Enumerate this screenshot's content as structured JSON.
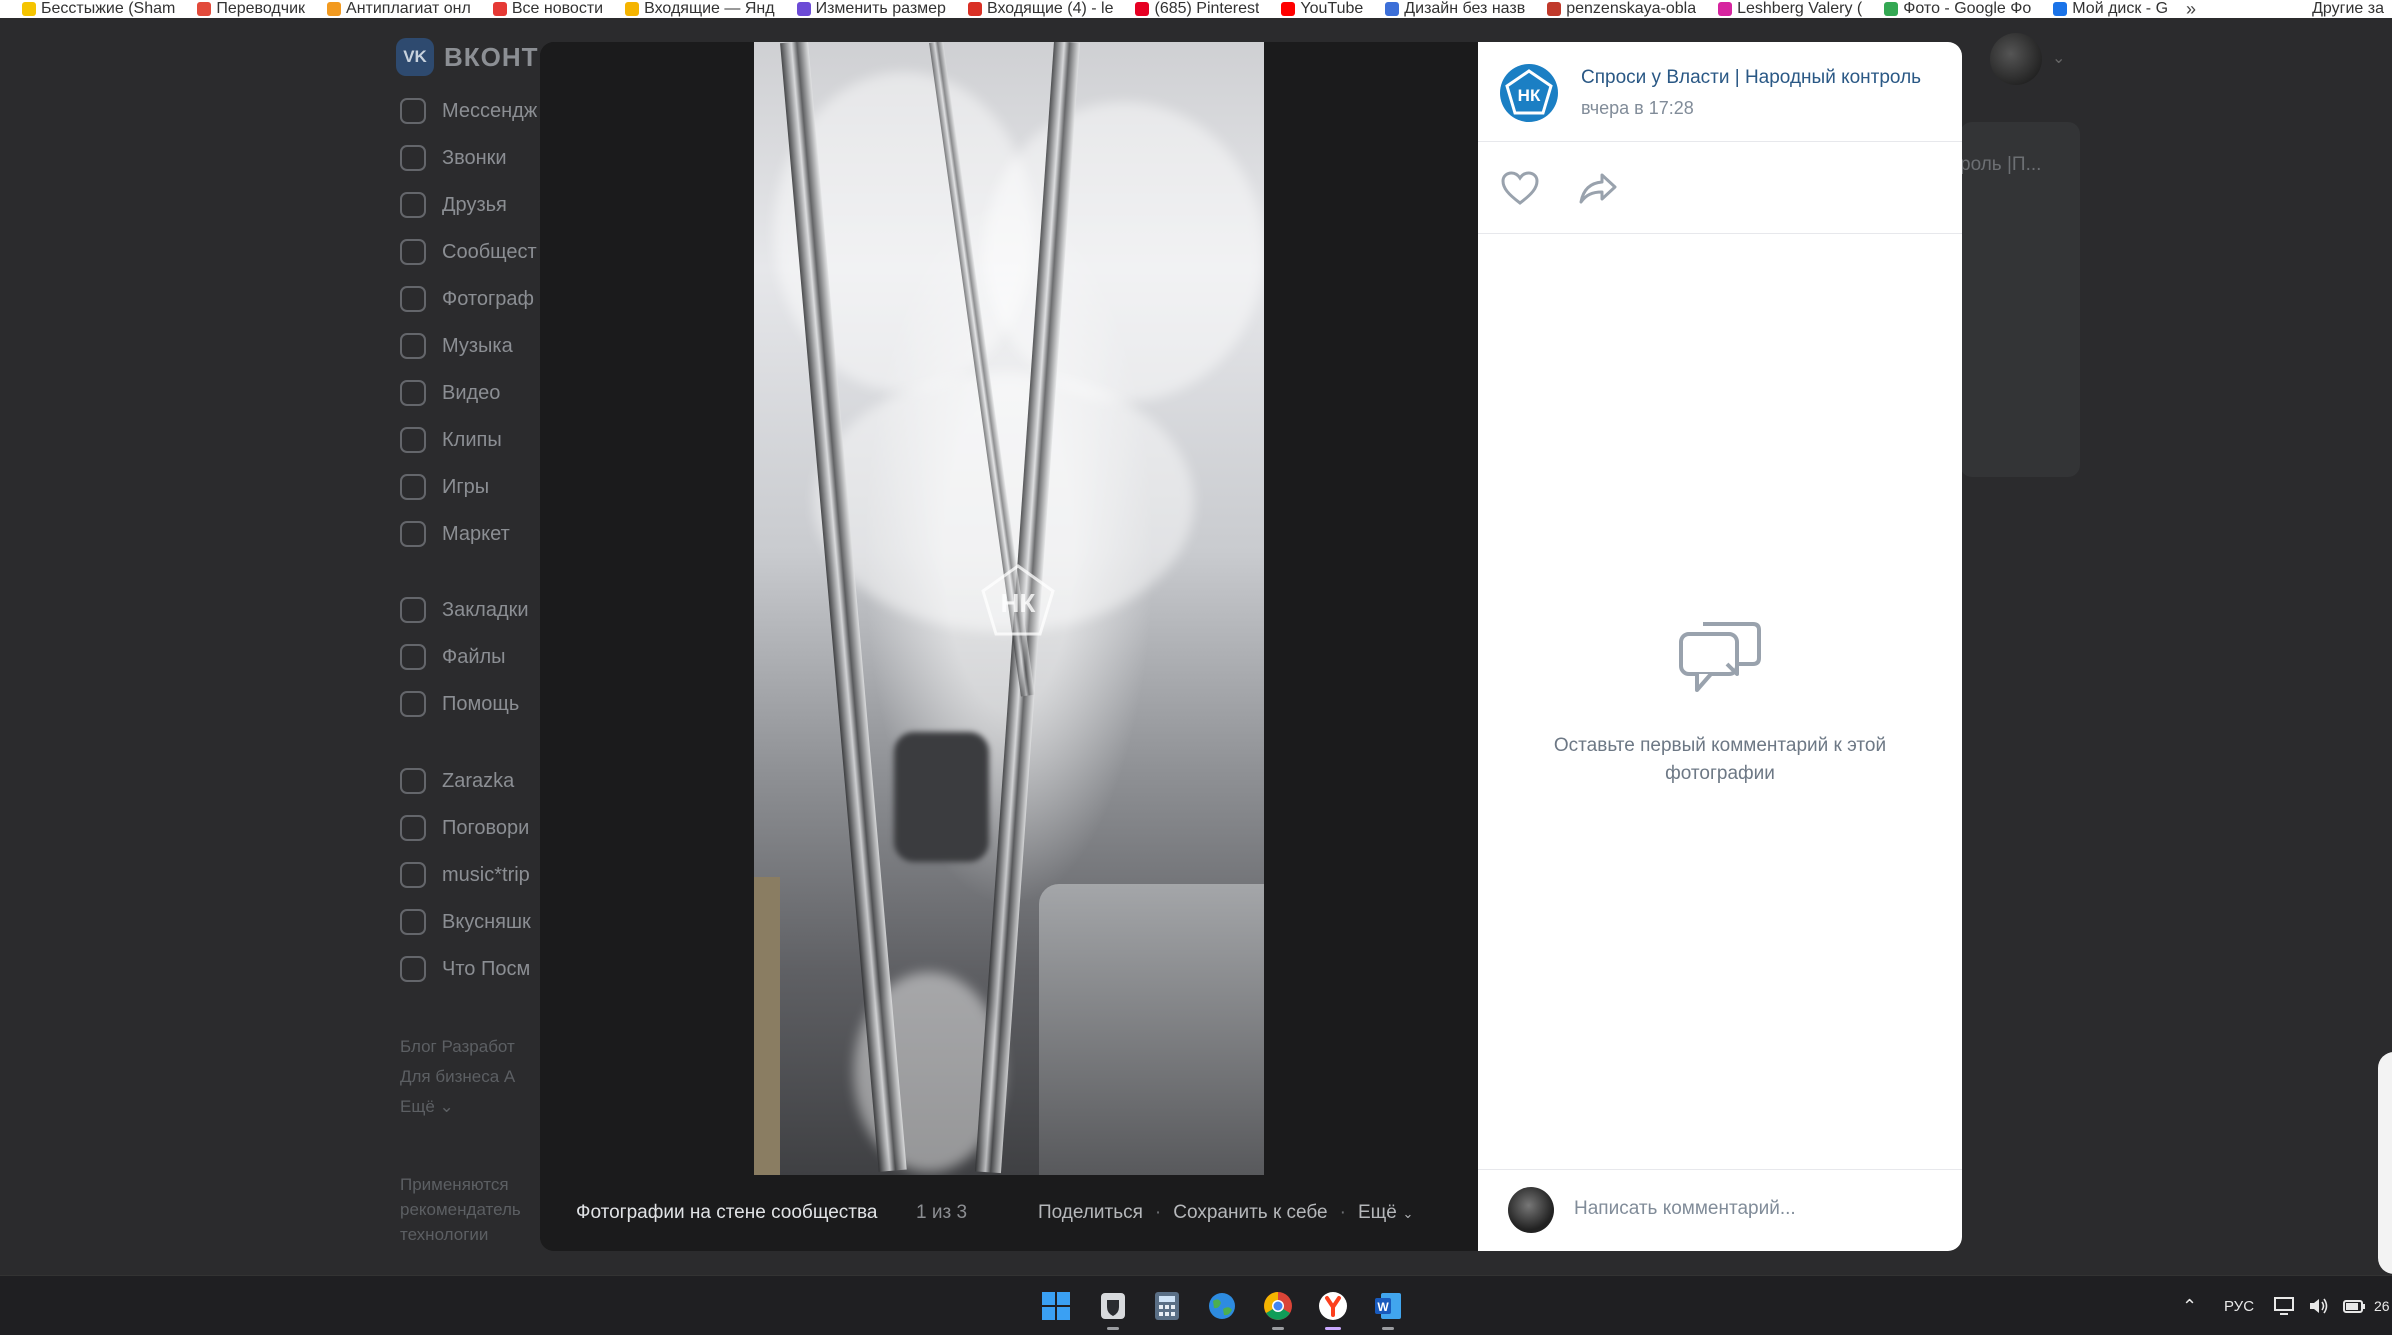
{
  "browser": {
    "bookmarks": [
      {
        "label": "Бесстыжие (Sham",
        "color": "#f5c400"
      },
      {
        "label": "Переводчик",
        "color": "#e24a3b"
      },
      {
        "label": "Антиплагиат онл",
        "color": "#f29a20"
      },
      {
        "label": "Все новости",
        "color": "#e53935"
      },
      {
        "label": "Входящие — Янд",
        "color": "#f5b400"
      },
      {
        "label": "Изменить размер",
        "color": "#6c4bd6"
      },
      {
        "label": "Входящие (4) - le",
        "color": "#d93025"
      },
      {
        "label": "(685) Pinterest",
        "color": "#e60023"
      },
      {
        "label": "YouTube",
        "color": "#ff0000"
      },
      {
        "label": "Дизайн без назв",
        "color": "#3c6fd8"
      },
      {
        "label": "penzenskaya-obla",
        "color": "#c0392b"
      },
      {
        "label": "Leshberg Valery (",
        "color": "#d6249f"
      },
      {
        "label": "Фото - Google Фо",
        "color": "#34a853"
      },
      {
        "label": "Мой диск - G",
        "color": "#1a73e8"
      }
    ],
    "more": "»",
    "other_bookmarks": "Другие за"
  },
  "vk": {
    "logo_short": "VK",
    "logo_text": "ВКОНТ",
    "menu": [
      {
        "label": "Мессендж",
        "icon": "chat-icon"
      },
      {
        "label": "Звонки",
        "icon": "phone-icon"
      },
      {
        "label": "Друзья",
        "icon": "friends-icon"
      },
      {
        "label": "Сообщест",
        "icon": "communities-icon"
      },
      {
        "label": "Фотограф",
        "icon": "photo-icon"
      },
      {
        "label": "Музыка",
        "icon": "music-icon"
      },
      {
        "label": "Видео",
        "icon": "video-icon"
      },
      {
        "label": "Клипы",
        "icon": "clips-icon"
      },
      {
        "label": "Игры",
        "icon": "games-icon"
      },
      {
        "label": "Маркет",
        "icon": "market-icon"
      },
      {
        "label": "Закладки",
        "icon": "bookmark-icon"
      },
      {
        "label": "Файлы",
        "icon": "file-icon"
      },
      {
        "label": "Помощь",
        "icon": "help-icon"
      },
      {
        "label": "Zarazka",
        "icon": "group-icon"
      },
      {
        "label": "Поговори",
        "icon": "group-icon"
      },
      {
        "label": "music*trip",
        "icon": "group-icon"
      },
      {
        "label": "Вкусняшк",
        "icon": "group-icon"
      },
      {
        "label": "Что Посм",
        "icon": "group-icon"
      }
    ],
    "footer_links": [
      "Блог  Разработ",
      "Для бизнеса  А",
      "Ещё ⌄"
    ],
    "footer_note": [
      "Применяются",
      "рекомендатель",
      "технологии"
    ],
    "right_card_text": "роль |П..."
  },
  "viewer": {
    "caption": "Фотографии на стене сообщества",
    "counter": "1 из 3",
    "actions": [
      "Поделиться",
      "Сохранить к себе",
      "Ещё"
    ],
    "watermark": "НК"
  },
  "panel": {
    "author": "Спроси у Власти | Народный контроль",
    "author_initials": "НК",
    "time": "вчера в 17:28",
    "empty_comments": "Оставьте первый комментарий к этой фотографии",
    "comment_placeholder": "Написать комментарий...",
    "brand_color": "#1b7fc4",
    "link_color": "#2a5885"
  },
  "taskbar": {
    "apps": [
      "windows-start-icon",
      "bitwarden-icon",
      "calculator-icon",
      "earth-browser-icon",
      "chrome-icon",
      "yandex-browser-icon",
      "word-icon"
    ],
    "lang": "РУС",
    "clock_fragment": "26"
  }
}
